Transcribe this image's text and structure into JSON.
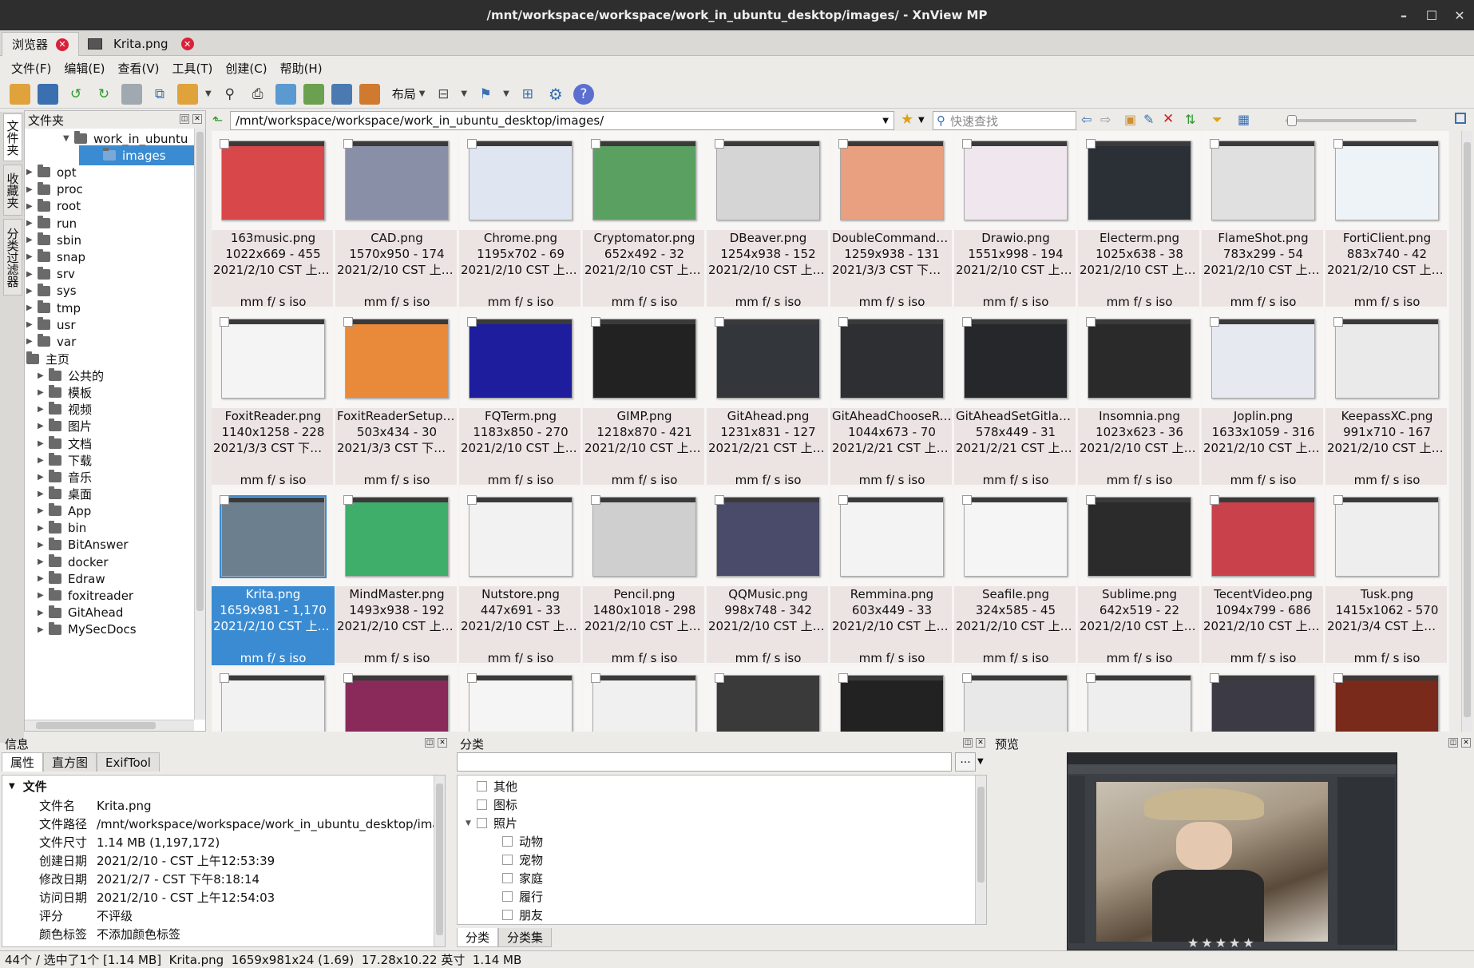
{
  "window": {
    "title": "/mnt/workspace/workspace/work_in_ubuntu_desktop/images/ - XnView MP"
  },
  "tabs": [
    {
      "label": "浏览器"
    },
    {
      "label": "Krita.png"
    }
  ],
  "menu": [
    "文件(F)",
    "编辑(E)",
    "查看(V)",
    "工具(T)",
    "创建(C)",
    "帮助(H)"
  ],
  "toolbar": {
    "layout_label": "布局"
  },
  "side_tabs": [
    "文件夹",
    "收藏夹",
    "分类过滤器"
  ],
  "folder_panel": {
    "title": "文件夹",
    "items": [
      {
        "label": "work_in_ubuntu",
        "depth": 3,
        "expanded": true
      },
      {
        "label": "images",
        "depth": 4,
        "selected": true
      },
      {
        "label": "opt",
        "depth": 0
      },
      {
        "label": "proc",
        "depth": 0
      },
      {
        "label": "root",
        "depth": 0
      },
      {
        "label": "run",
        "depth": 0
      },
      {
        "label": "sbin",
        "depth": 0
      },
      {
        "label": "snap",
        "depth": 0
      },
      {
        "label": "srv",
        "depth": 0
      },
      {
        "label": "sys",
        "depth": 0
      },
      {
        "label": "tmp",
        "depth": 0
      },
      {
        "label": "usr",
        "depth": 0
      },
      {
        "label": "var",
        "depth": 0
      },
      {
        "label": "主页",
        "depth": -1
      },
      {
        "label": "公共的",
        "depth": 1
      },
      {
        "label": "模板",
        "depth": 1
      },
      {
        "label": "视频",
        "depth": 1
      },
      {
        "label": "图片",
        "depth": 1
      },
      {
        "label": "文档",
        "depth": 1
      },
      {
        "label": "下载",
        "depth": 1
      },
      {
        "label": "音乐",
        "depth": 1
      },
      {
        "label": "桌面",
        "depth": 1
      },
      {
        "label": "App",
        "depth": 1
      },
      {
        "label": "bin",
        "depth": 1
      },
      {
        "label": "BitAnswer",
        "depth": 1
      },
      {
        "label": "docker",
        "depth": 1
      },
      {
        "label": "Edraw",
        "depth": 1
      },
      {
        "label": "foxitreader",
        "depth": 1
      },
      {
        "label": "GitAhead",
        "depth": 1
      },
      {
        "label": "MySecDocs",
        "depth": 1
      }
    ]
  },
  "address": {
    "path": "/mnt/workspace/workspace/work_in_ubuntu_desktop/images/",
    "quick_search_placeholder": "快速查找"
  },
  "thumbnails": [
    {
      "name": "163music.png",
      "size": "1022x669 - 455",
      "date": "2021/2/10 CST 上午...",
      "exif": "mm f/ s iso",
      "color": "#d8474a"
    },
    {
      "name": "CAD.png",
      "size": "1570x950 - 174",
      "date": "2021/2/10 CST 上午...",
      "exif": "mm f/ s iso",
      "color": "#8a8fa8"
    },
    {
      "name": "Chrome.png",
      "size": "1195x702 - 69",
      "date": "2021/2/10 CST 上午...",
      "exif": "mm f/ s iso",
      "color": "#dfe6f2"
    },
    {
      "name": "Cryptomator.png",
      "size": "652x492 - 32",
      "date": "2021/2/10 CST 上午...",
      "exif": "mm f/ s iso",
      "color": "#5aa060"
    },
    {
      "name": "DBeaver.png",
      "size": "1254x938 - 152",
      "date": "2021/2/10 CST 上午...",
      "exif": "mm f/ s iso",
      "color": "#d5d5d5"
    },
    {
      "name": "DoubleCommander...",
      "size": "1259x938 - 131",
      "date": "2021/3/3 CST 下午1...",
      "exif": "mm f/ s iso",
      "color": "#e8a080"
    },
    {
      "name": "Drawio.png",
      "size": "1551x998 - 194",
      "date": "2021/2/10 CST 上午...",
      "exif": "mm f/ s iso",
      "color": "#f0e6ee"
    },
    {
      "name": "Electerm.png",
      "size": "1025x638 - 38",
      "date": "2021/2/10 CST 上午...",
      "exif": "mm f/ s iso",
      "color": "#2b2f36"
    },
    {
      "name": "FlameShot.png",
      "size": "783x299 - 54",
      "date": "2021/2/10 CST 上午...",
      "exif": "mm f/ s iso",
      "color": "#e0e0e0"
    },
    {
      "name": "FortiClient.png",
      "size": "883x740 - 42",
      "date": "2021/2/10 CST 上午...",
      "exif": "mm f/ s iso",
      "color": "#eef3f8"
    },
    {
      "name": "FoxitReader.png",
      "size": "1140x1258 - 228",
      "date": "2021/3/3 CST 下午1...",
      "exif": "mm f/ s iso",
      "color": "#f4f4f4"
    },
    {
      "name": "FoxitReaderSetup.p...",
      "size": "503x434 - 30",
      "date": "2021/3/3 CST 下午1...",
      "exif": "mm f/ s iso",
      "color": "#e98a3a"
    },
    {
      "name": "FQTerm.png",
      "size": "1183x850 - 270",
      "date": "2021/2/10 CST 上午...",
      "exif": "mm f/ s iso",
      "color": "#1d1d9e"
    },
    {
      "name": "GIMP.png",
      "size": "1218x870 - 421",
      "date": "2021/2/10 CST 上午...",
      "exif": "mm f/ s iso",
      "color": "#222222"
    },
    {
      "name": "GitAhead.png",
      "size": "1231x831 - 127",
      "date": "2021/2/21 CST 上午...",
      "exif": "mm f/ s iso",
      "color": "#33363b"
    },
    {
      "name": "GitAheadChooseRe...",
      "size": "1044x673 - 70",
      "date": "2021/2/21 CST 上午...",
      "exif": "mm f/ s iso",
      "color": "#2d2f33"
    },
    {
      "name": "GitAheadSetGitlab....",
      "size": "578x449 - 31",
      "date": "2021/2/21 CST 上午...",
      "exif": "mm f/ s iso",
      "color": "#25272b"
    },
    {
      "name": "Insomnia.png",
      "size": "1023x623 - 36",
      "date": "2021/2/10 CST 上午...",
      "exif": "mm f/ s iso",
      "color": "#2a2a2a"
    },
    {
      "name": "Joplin.png",
      "size": "1633x1059 - 316",
      "date": "2021/2/10 CST 上午...",
      "exif": "mm f/ s iso",
      "color": "#e6e9ef"
    },
    {
      "name": "KeepassXC.png",
      "size": "991x710 - 167",
      "date": "2021/2/10 CST 上午...",
      "exif": "mm f/ s iso",
      "color": "#eaeaea"
    },
    {
      "name": "Krita.png",
      "size": "1659x981 - 1,170",
      "date": "2021/2/10 CST 上午...",
      "exif": "mm f/ s iso",
      "color": "#6b7f8f",
      "selected": true
    },
    {
      "name": "MindMaster.png",
      "size": "1493x938 - 192",
      "date": "2021/2/10 CST 上午...",
      "exif": "mm f/ s iso",
      "color": "#3fae6a"
    },
    {
      "name": "Nutstore.png",
      "size": "447x691 - 33",
      "date": "2021/2/10 CST 上午...",
      "exif": "mm f/ s iso",
      "color": "#f2f2f2"
    },
    {
      "name": "Pencil.png",
      "size": "1480x1018 - 298",
      "date": "2021/2/10 CST 上午...",
      "exif": "mm f/ s iso",
      "color": "#cfcfcf"
    },
    {
      "name": "QQMusic.png",
      "size": "998x748 - 342",
      "date": "2021/2/10 CST 上午...",
      "exif": "mm f/ s iso",
      "color": "#4a4a6a"
    },
    {
      "name": "Remmina.png",
      "size": "603x449 - 33",
      "date": "2021/2/10 CST 上午...",
      "exif": "mm f/ s iso",
      "color": "#f3f3f3"
    },
    {
      "name": "Seafile.png",
      "size": "324x585 - 45",
      "date": "2021/2/10 CST 上午...",
      "exif": "mm f/ s iso",
      "color": "#f5f5f5"
    },
    {
      "name": "Sublime.png",
      "size": "642x519 - 22",
      "date": "2021/2/10 CST 上午...",
      "exif": "mm f/ s iso",
      "color": "#2b2b2b"
    },
    {
      "name": "TecentVideo.png",
      "size": "1094x799 - 686",
      "date": "2021/2/10 CST 上午...",
      "exif": "mm f/ s iso",
      "color": "#c9414a"
    },
    {
      "name": "Tusk.png",
      "size": "1415x1062 - 570",
      "date": "2021/3/4 CST 上午1...",
      "exif": "mm f/ s iso",
      "color": "#eeeeee"
    },
    {
      "name": "",
      "size": "",
      "date": "",
      "exif": "",
      "color": "#f2f2f2"
    },
    {
      "name": "",
      "size": "",
      "date": "",
      "exif": "",
      "color": "#8a2a5a"
    },
    {
      "name": "",
      "size": "",
      "date": "",
      "exif": "",
      "color": "#f5f5f5"
    },
    {
      "name": "",
      "size": "",
      "date": "",
      "exif": "",
      "color": "#f0f0f0"
    },
    {
      "name": "",
      "size": "",
      "date": "",
      "exif": "",
      "color": "#3a3a3a"
    },
    {
      "name": "",
      "size": "",
      "date": "",
      "exif": "",
      "color": "#222222"
    },
    {
      "name": "",
      "size": "",
      "date": "",
      "exif": "",
      "color": "#e8e8e8"
    },
    {
      "name": "",
      "size": "",
      "date": "",
      "exif": "",
      "color": "#eeeeee"
    },
    {
      "name": "",
      "size": "",
      "date": "",
      "exif": "",
      "color": "#3c3a45"
    },
    {
      "name": "",
      "size": "",
      "date": "",
      "exif": "",
      "color": "#7a2a1a"
    }
  ],
  "info_panel": {
    "title": "信息",
    "tabs": [
      "属性",
      "直方图",
      "ExifTool"
    ],
    "section": "文件",
    "rows": [
      {
        "k": "文件名",
        "v": "Krita.png"
      },
      {
        "k": "文件路径",
        "v": "/mnt/workspace/workspace/work_in_ubuntu_desktop/images"
      },
      {
        "k": "文件尺寸",
        "v": "1.14 MB (1,197,172)"
      },
      {
        "k": "创建日期",
        "v": "2021/2/10 - CST 上午12:53:39"
      },
      {
        "k": "修改日期",
        "v": "2021/2/7 - CST 下午8:18:14"
      },
      {
        "k": "访问日期",
        "v": "2021/2/10 - CST 上午12:54:03"
      },
      {
        "k": "评分",
        "v": "不评级"
      },
      {
        "k": "颜色标签",
        "v": "不添加颜色标签"
      }
    ]
  },
  "category_panel": {
    "title": "分类",
    "more_label": "...",
    "items": [
      {
        "label": "其他",
        "level": 0
      },
      {
        "label": "图标",
        "level": 0
      },
      {
        "label": "照片",
        "level": 0,
        "expanded": true
      },
      {
        "label": "动物",
        "level": 1
      },
      {
        "label": "宠物",
        "level": 1
      },
      {
        "label": "家庭",
        "level": 1
      },
      {
        "label": "履行",
        "level": 1
      },
      {
        "label": "朋友",
        "level": 1
      }
    ],
    "tabs": [
      "分类",
      "分类集"
    ]
  },
  "preview_panel": {
    "title": "预览"
  },
  "status": {
    "count": "44个 / 选中了1个 [1.14 MB]",
    "file": "Krita.png",
    "dims": "1659x981x24 (1.69)",
    "print": "17.28x10.22 英寸",
    "size": "1.14 MB"
  }
}
